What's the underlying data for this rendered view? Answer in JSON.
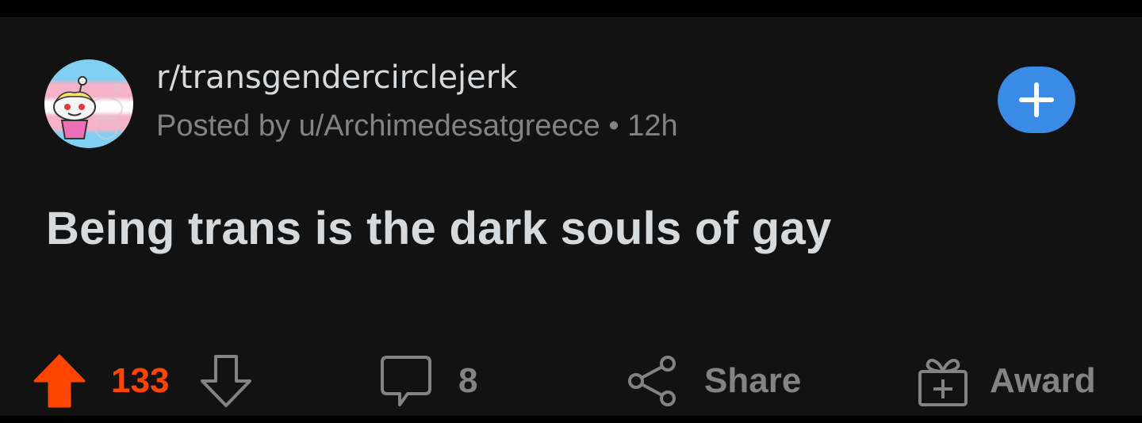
{
  "post": {
    "subreddit": "r/transgendercirclejerk",
    "posted_by_prefix": "Posted by",
    "author": "u/Archimedesatgreece",
    "separator": "•",
    "age": "12h",
    "title": "Being trans is the dark souls of gay"
  },
  "actions": {
    "upvotes": "133",
    "comments": "8",
    "share_label": "Share",
    "award_label": "Award"
  },
  "colors": {
    "background": "#121212",
    "text": "#d7dadc",
    "muted": "#818384",
    "upvote_active": "#ff4500",
    "join_button": "#3a8be6"
  },
  "icons": {
    "avatar": "subreddit-avatar-icon",
    "join": "plus-icon",
    "upvote": "upvote-arrow-icon",
    "downvote": "downvote-arrow-icon",
    "comment": "comment-bubble-icon",
    "share": "share-icon",
    "award": "gift-icon"
  }
}
